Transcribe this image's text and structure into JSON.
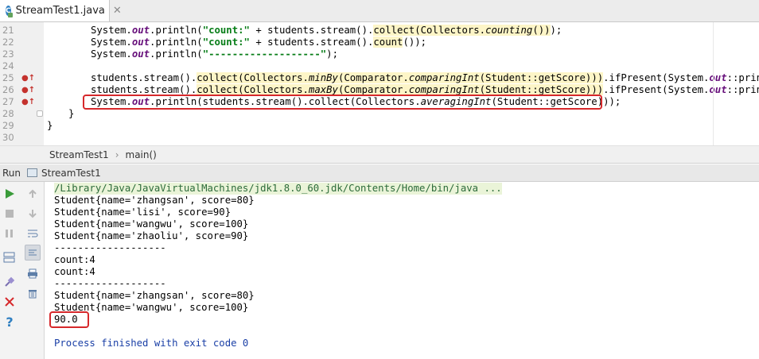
{
  "tab": {
    "title": "StreamTest1.java",
    "close": "✕",
    "icon_letter": "C"
  },
  "editor": {
    "lines": [
      {
        "n": "21",
        "marker": ""
      },
      {
        "n": "22",
        "marker": ""
      },
      {
        "n": "23",
        "marker": ""
      },
      {
        "n": "24",
        "marker": ""
      },
      {
        "n": "25",
        "marker": "●↑"
      },
      {
        "n": "26",
        "marker": "●↑"
      },
      {
        "n": "27",
        "marker": "●↑"
      },
      {
        "n": "28",
        "marker": ""
      },
      {
        "n": "29",
        "marker": ""
      },
      {
        "n": "30",
        "marker": ""
      }
    ],
    "code": {
      "l21": {
        "p1": "System.",
        "out": "out",
        "p2": ".println(",
        "str": "\"count:\"",
        "p3": " + students.stream().",
        "hl1": "collect(Collectors.",
        "hl_it": "counting",
        "hl2": "())",
        "p4": ");"
      },
      "l22": {
        "p1": "System.",
        "out": "out",
        "p2": ".println(",
        "str": "\"count:\"",
        "p3": " + students.stream().",
        "hl": "count",
        "p4": "());"
      },
      "l23": {
        "p1": "System.",
        "out": "out",
        "p2": ".println(",
        "str": "\"-------------------\"",
        "p4": ");"
      },
      "l25": {
        "p1": "students.stream().",
        "hl1": "collect(Collectors.",
        "hl_it": "minBy",
        "hl2": "(Comparator.",
        "hl_it2": "comparingInt",
        "hl3": "(Student::getScore)))",
        "p2": ".ifPresent(System.",
        "out": "out",
        "p3": "::println);"
      },
      "l26": {
        "p1": "students.stream().",
        "hl1": "collect(Collectors.",
        "hl_it": "maxBy",
        "hl2": "(Comparator.",
        "hl_it2": "comparingInt",
        "hl3": "(Student::getScore)))",
        "p2": ".ifPresent(System.",
        "out": "out",
        "p3": "::println);"
      },
      "l27": {
        "p1": "System.",
        "out": "out",
        "p2": ".println(students.stream().collect(Collectors.",
        "it": "averagingInt",
        "p3": "(Student::getScore)));"
      },
      "l28": "}",
      "l29": "}"
    }
  },
  "breadcrumb": {
    "items": [
      "StreamTest1",
      "main()"
    ],
    "sep": "›"
  },
  "run_panel": {
    "label": "Run",
    "config": "StreamTest1",
    "console": [
      "/Library/Java/JavaVirtualMachines/jdk1.8.0_60.jdk/Contents/Home/bin/java ...",
      "Student{name='zhangsan', score=80}",
      "Student{name='lisi', score=90}",
      "Student{name='wangwu', score=100}",
      "Student{name='zhaoliu', score=90}",
      "-------------------",
      "count:4",
      "count:4",
      "-------------------",
      "Student{name='zhangsan', score=80}",
      "Student{name='wangwu', score=100}",
      "90.0",
      "",
      "Process finished with exit code 0"
    ]
  },
  "colors": {
    "highlight_box": "#d6282b",
    "run_green": "#3a9b3a",
    "stop_red": "#d6282b"
  }
}
